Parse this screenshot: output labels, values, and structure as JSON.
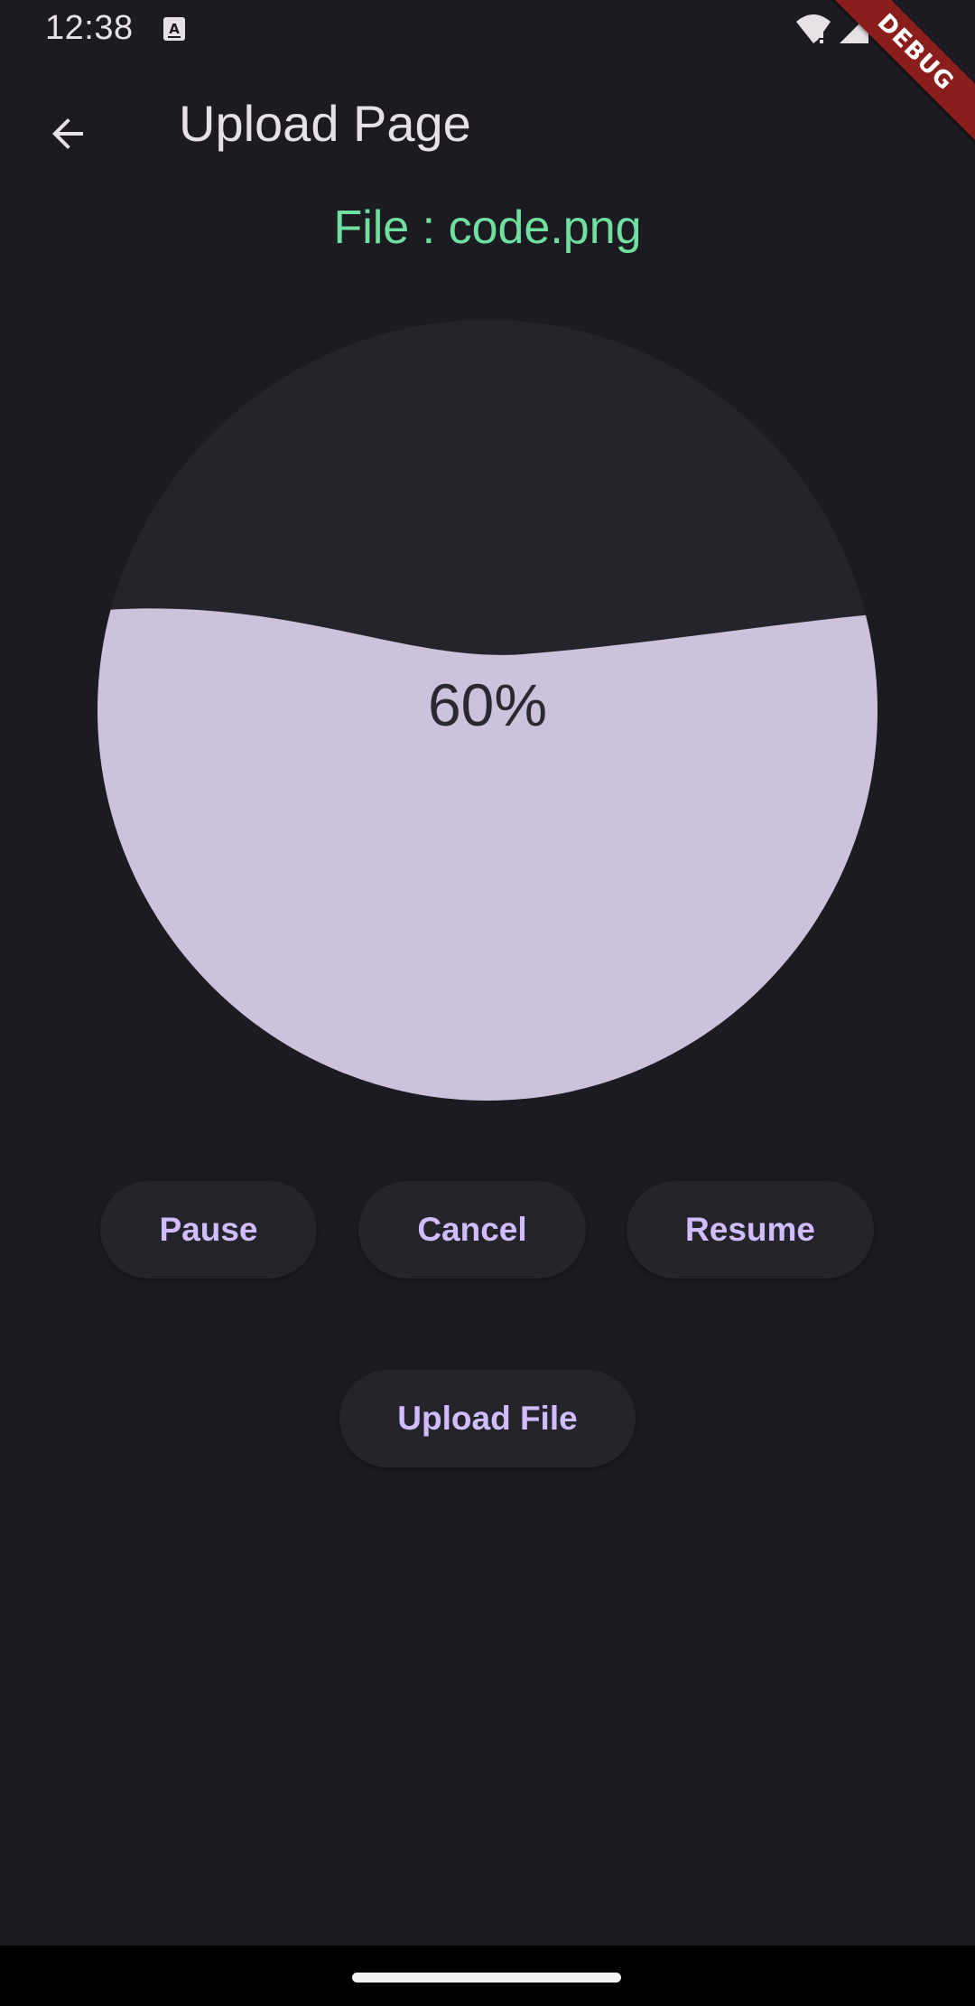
{
  "status_bar": {
    "time": "12:38"
  },
  "debug_banner": {
    "label": "DEBUG"
  },
  "app_bar": {
    "title": "Upload Page",
    "back_icon": "arrow-back-icon"
  },
  "file": {
    "label": "File : code.png"
  },
  "progress": {
    "value": 0.6,
    "label": "60%",
    "fill_color": "#ccc2dc",
    "track_color": "#25242b"
  },
  "actions": {
    "pause": "Pause",
    "cancel": "Cancel",
    "resume": "Resume",
    "upload": "Upload File"
  },
  "colors": {
    "background": "#1c1b21",
    "accent": "#d0bcff",
    "file_label": "#6fe0a0"
  }
}
